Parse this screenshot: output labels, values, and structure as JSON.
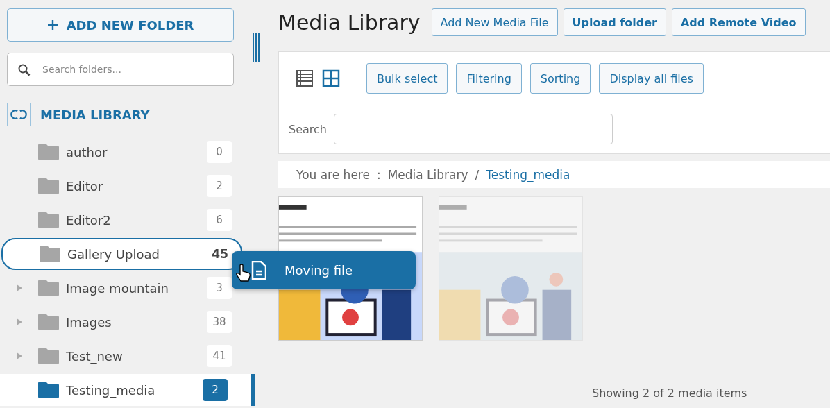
{
  "sidebar": {
    "add_button": "ADD NEW FOLDER",
    "search": {
      "placeholder": "Search folders..."
    },
    "root": "MEDIA LIBRARY",
    "folders": [
      {
        "name": "author",
        "count": "0",
        "has_children": false,
        "selected": false,
        "drop_target": false
      },
      {
        "name": "Editor",
        "count": "2",
        "has_children": false,
        "selected": false,
        "drop_target": false
      },
      {
        "name": "Editor2",
        "count": "6",
        "has_children": false,
        "selected": false,
        "drop_target": false
      },
      {
        "name": "Gallery Upload",
        "count": "45",
        "has_children": false,
        "selected": false,
        "drop_target": true
      },
      {
        "name": "Image mountain",
        "count": "3",
        "has_children": true,
        "selected": false,
        "drop_target": false
      },
      {
        "name": "Images",
        "count": "38",
        "has_children": true,
        "selected": false,
        "drop_target": false
      },
      {
        "name": "Test_new",
        "count": "41",
        "has_children": true,
        "selected": false,
        "drop_target": false
      },
      {
        "name": "Testing_media",
        "count": "2",
        "has_children": false,
        "selected": true,
        "drop_target": false
      }
    ]
  },
  "drag_tooltip": "Moving file",
  "main": {
    "title": "Media Library",
    "header_buttons": [
      {
        "label": "Add New Media File",
        "bold": false
      },
      {
        "label": "Upload folder",
        "bold": true
      },
      {
        "label": "Add Remote Video",
        "bold": true
      }
    ],
    "view_modes": [
      {
        "kind": "list",
        "selected": false
      },
      {
        "kind": "grid",
        "selected": true
      }
    ],
    "toolbar_buttons": [
      "Bulk select",
      "Filtering",
      "Sorting",
      "Display all files"
    ],
    "search_label": "Search",
    "breadcrumb": {
      "prefix": "You are here",
      "separator": ":",
      "path": [
        {
          "label": "Media Library",
          "current": false
        },
        {
          "label": "Testing_media",
          "current": true
        }
      ],
      "path_separator": "/"
    },
    "items": [
      {
        "kind": "picture",
        "faded": false
      },
      {
        "kind": "picture",
        "faded": true
      }
    ],
    "footer": "Showing 2 of 2 media items"
  }
}
